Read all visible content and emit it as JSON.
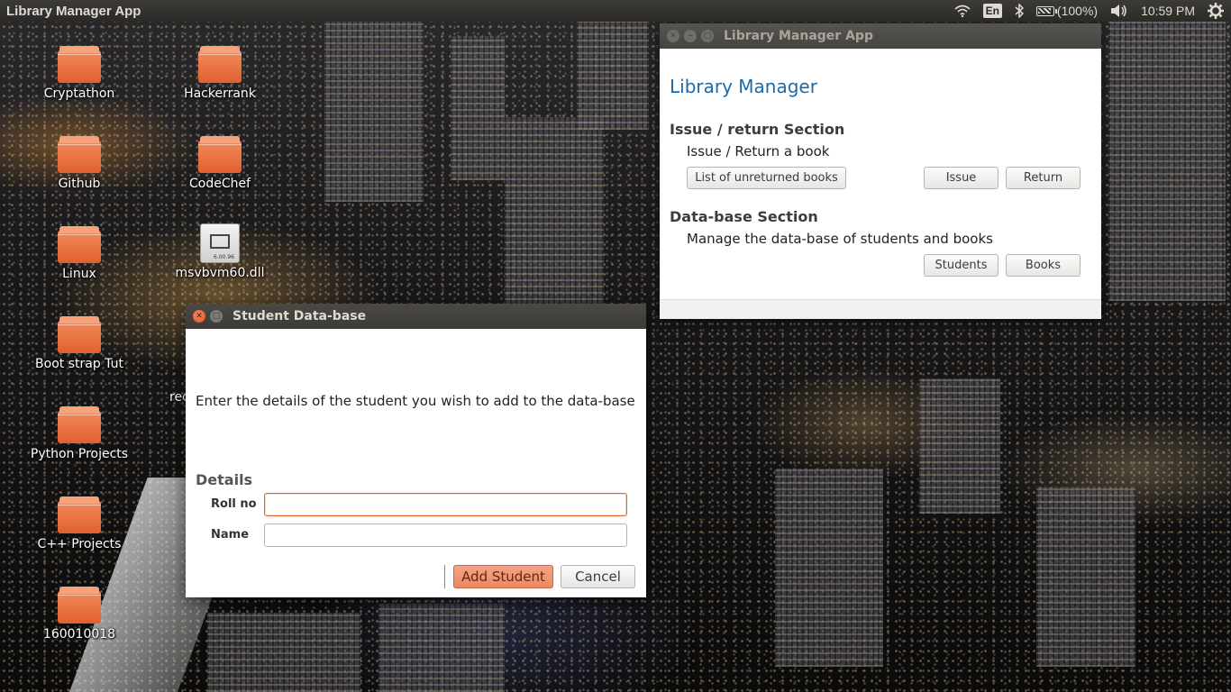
{
  "top_panel": {
    "app_title": "Library Manager App",
    "keyboard_layout": "En",
    "battery": "(100%)",
    "clock": "10:59 PM",
    "icons": [
      "wifi-icon",
      "bluetooth-icon",
      "battery-icon",
      "volume-icon",
      "gear-icon"
    ]
  },
  "desktop": {
    "icons": [
      {
        "label": "Cryptathon",
        "type": "folder"
      },
      {
        "label": "Hackerrank",
        "type": "folder"
      },
      {
        "label": "Github",
        "type": "folder"
      },
      {
        "label": "CodeChef",
        "type": "folder"
      },
      {
        "label": "Linux",
        "type": "folder"
      },
      {
        "label": "msvbvm60.dll",
        "type": "file",
        "badge": "6.00.96"
      },
      {
        "label": "Boot strap Tut",
        "type": "folder"
      },
      {
        "label": "Python Projects",
        "type": "folder"
      },
      {
        "label": "C++ Projects",
        "type": "folder"
      },
      {
        "label": "160010018",
        "type": "folder"
      }
    ],
    "partial_label": "rec"
  },
  "library_window": {
    "title": "Library Manager App",
    "heading": "Library Manager",
    "issue_section": {
      "title": "Issue / return Section",
      "subtitle": "Issue / Return a book",
      "buttons": {
        "unreturned": "List of unreturned books",
        "issue": "Issue",
        "return": "Return"
      }
    },
    "database_section": {
      "title": "Data-base Section",
      "subtitle": "Manage the data-base of students and books",
      "buttons": {
        "students": "Students",
        "books": "Books"
      }
    }
  },
  "student_window": {
    "title": "Student Data-base",
    "message": "Enter the details of the student you wish to add to the data-base",
    "details_heading": "Details",
    "fields": {
      "roll_label": "Roll no",
      "roll_value": "",
      "name_label": "Name",
      "name_value": ""
    },
    "buttons": {
      "add": "Add Student",
      "cancel": "Cancel"
    }
  },
  "colors": {
    "accent": "#e4652d",
    "heading_blue": "#1e6aa6",
    "panel_bg": "#3c3b37"
  }
}
